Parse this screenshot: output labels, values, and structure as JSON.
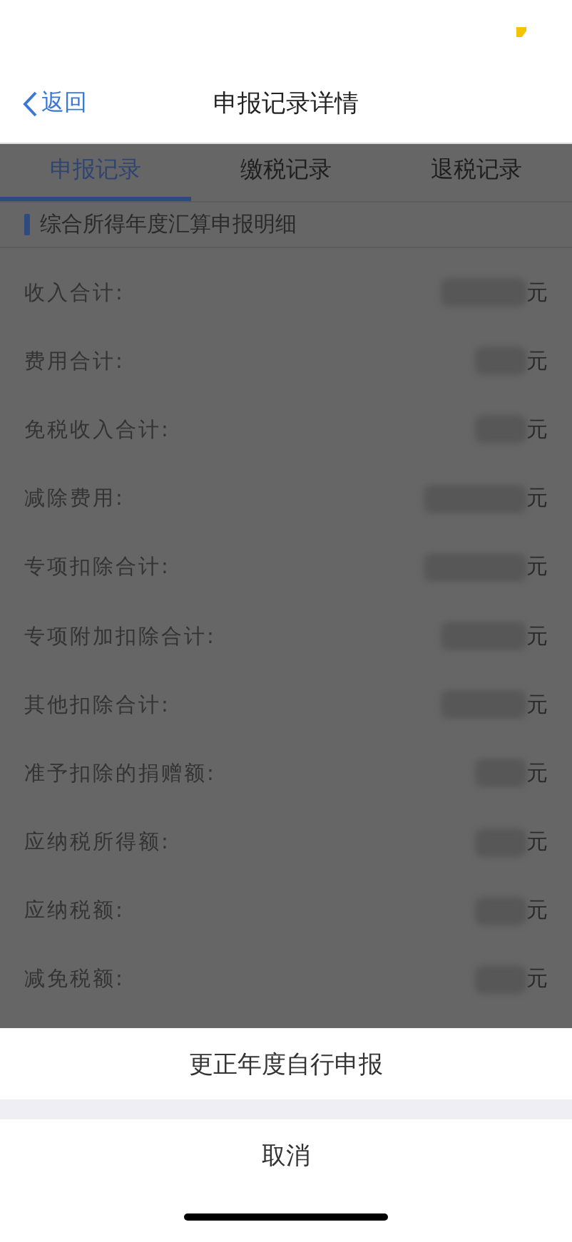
{
  "nav_bar": {
    "back": "返回",
    "title": "申报记录详情"
  },
  "tabs": [
    {
      "label": "申报记录",
      "selected": true
    },
    {
      "label": "缴税记录",
      "selected": false
    },
    {
      "label": "退税记录",
      "selected": false
    }
  ],
  "section_title": "综合所得年度汇算申报明细",
  "rows": [
    {
      "label": "收入合计:",
      "unit": "元"
    },
    {
      "label": "费用合计:",
      "unit": "元"
    },
    {
      "label": "免税收入合计:",
      "unit": "元"
    },
    {
      "label": "减除费用:",
      "unit": "元"
    },
    {
      "label": "专项扣除合计:",
      "unit": "元"
    },
    {
      "label": "专项附加扣除合计:",
      "unit": "元"
    },
    {
      "label": "其他扣除合计:",
      "unit": "元"
    },
    {
      "label": "准予扣除的捐赠额:",
      "unit": "元"
    },
    {
      "label": "应纳税所得额:",
      "unit": "元"
    },
    {
      "label": "应纳税额:",
      "unit": "元"
    },
    {
      "label": "减免税额:",
      "unit": "元"
    }
  ],
  "action_sheet": [
    {
      "kind": "action",
      "label": "更正年度自行申报"
    },
    {
      "kind": "cancel",
      "label": "取消"
    }
  ]
}
